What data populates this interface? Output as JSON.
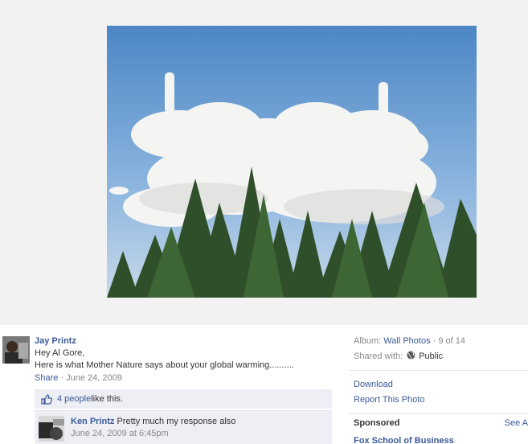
{
  "photo": {
    "alt": ""
  },
  "post": {
    "author": "Jay Printz",
    "message_line1": "Hey Al Gore,",
    "message_line2": "Here is what Mother Nature says about your global warming..........",
    "share_label": "Share",
    "separator": " · ",
    "date": "June 24, 2009",
    "likes_link": "4 people",
    "likes_suffix": " like this.",
    "comment": {
      "author": "Ken Printz",
      "text": " Pretty much my response also",
      "date": "June 24, 2009 at 6:45pm"
    }
  },
  "info": {
    "album_label": "Album: ",
    "album_link": "Wall Photos",
    "album_count": " · 9 of 14",
    "shared_label": "Shared with: ",
    "shared_value": "Public",
    "download": "Download",
    "report": "Report This Photo",
    "sponsored": "Sponsored",
    "see_all": "See A",
    "ad_title": "Fox School of Business"
  },
  "colors": {
    "link": "#3b5998",
    "sky": "#5f97cf",
    "panel": "#edeff4"
  },
  "icons": {
    "like": "thumbs-up-icon",
    "audience": "globe-icon"
  }
}
